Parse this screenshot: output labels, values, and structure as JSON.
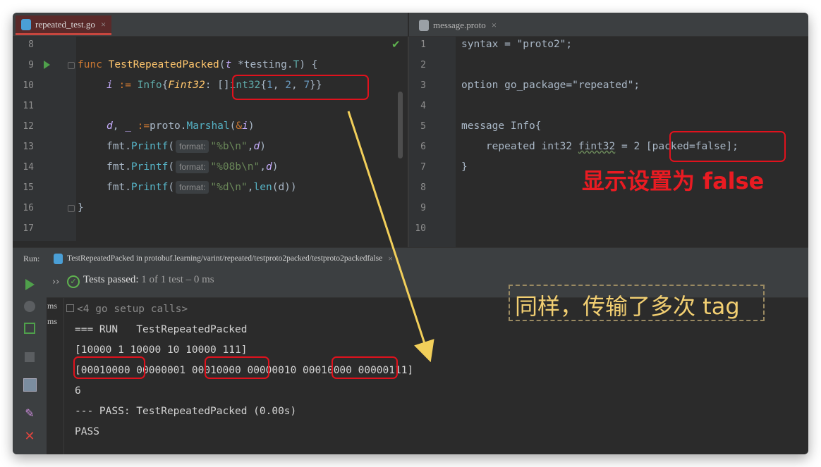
{
  "tabs": {
    "left_file": "repeated_test.go",
    "right_file": "message.proto",
    "close_glyph": "×"
  },
  "go_code": {
    "line_numbers": [
      "8",
      "9",
      "10",
      "11",
      "12",
      "13",
      "14",
      "15",
      "16",
      "17"
    ],
    "l9_func": "func ",
    "l9_name": "TestRepeatedPacked",
    "l9_open": "(",
    "l9_param": "t",
    "l9_star": " *",
    "l9_pkg": "testing.",
    "l9_type": "T",
    "l9_close": ") {",
    "l10_var": "i",
    "l10_assign": " := ",
    "l10_type": "Info",
    "l10_brace": "{",
    "l10_field": "Fint32",
    "l10_colon": ": ",
    "l10_slice": "[]",
    "l10_int": "int32",
    "l10_ob": "{",
    "l10_n1": "1",
    "l10_c1": ", ",
    "l10_n2": "2",
    "l10_c2": ", ",
    "l10_n3": "7",
    "l10_end": "}}",
    "l12_d": "d",
    "l12_comma": ", ",
    "l12_blank": "_",
    "l12_assign": " :=",
    "l12_proto": "proto.",
    "l12_marshal": "Marshal",
    "l12_op": "(",
    "l12_amp": "&",
    "l12_i": "i",
    "l12_cp": ")",
    "fmt": "fmt.",
    "printf": "Printf",
    "open_paren": "(",
    "hint_format": "format:",
    "l13_str": "\"%b\\n\"",
    "l14_str": "\"%08b\\n\"",
    "l15_str": "\"%d\\n\"",
    "comma": ",",
    "d": "d",
    "close_paren": ")",
    "len": "len",
    "l15_close": "(d))",
    "l16": "}"
  },
  "proto_code": {
    "line_numbers": [
      "1",
      "2",
      "3",
      "4",
      "5",
      "6",
      "7",
      "8",
      "9",
      "10"
    ],
    "l1": "syntax = \"proto2\";",
    "l3": "option go_package=\"repeated\";",
    "l5": "message Info{",
    "l6_a": "    repeated int32 ",
    "l6_field": "fint32",
    "l6_b": " = 2 ",
    "l6_opt": "[packed=false];",
    "l7": "}"
  },
  "run": {
    "label": "Run:",
    "config": "TestRepeatedPacked in protobuf.learning/varint/repeated/testproto2packed/testproto2packedfalse",
    "chevron": "››",
    "passed_prefix": "Tests passed: ",
    "passed_count": "1 of 1 test – 0 ms",
    "tree_times": [
      ") ms",
      ") ms"
    ]
  },
  "console": {
    "setup": "<4 go setup calls>",
    "l_run": "=== RUN   TestRepeatedPacked",
    "l_bits": "[10000 1 10000 10 10000 111]",
    "b1": "[00010000",
    "b2": " 00000001 ",
    "b3": "00010000",
    "b4": " 00000010 ",
    "b5": "00010000",
    "b6": " 00000111]",
    "l_len": "6",
    "l_pass": "--- PASS: TestRepeatedPacked (0.00s)",
    "l_final": "PASS"
  },
  "annotations": {
    "red_note": "显示设置为 false",
    "yellow_note": "同样，传输了多次 tag"
  },
  "colors": {
    "red_annotation": "#ea1b22",
    "yellow_annotation": "#f2cf72",
    "pass_green": "#5fb34f"
  }
}
